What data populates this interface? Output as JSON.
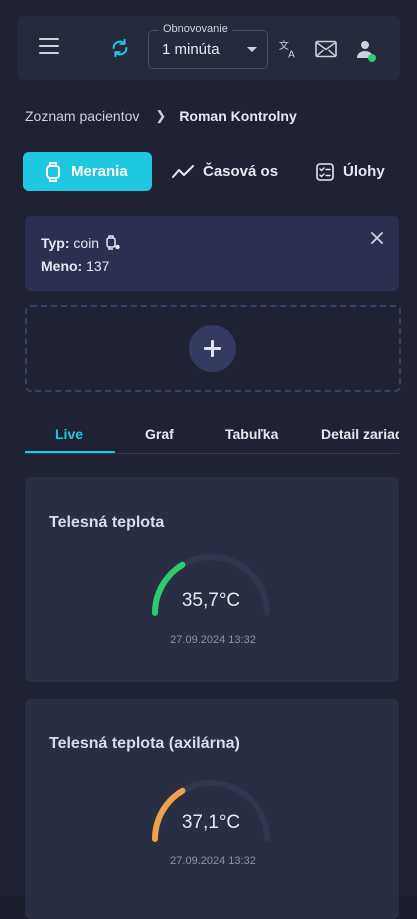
{
  "header": {
    "refresh_select": {
      "legend": "Obnovovanie",
      "value": "1 minúta"
    },
    "icons": [
      "menu-icon",
      "refresh-icon",
      "translate-icon",
      "mail-icon",
      "user-icon"
    ],
    "status_color": "#2ecc71"
  },
  "breadcrumb": {
    "parent": "Zoznam pacientov",
    "current": "Roman Kontrolny"
  },
  "tabs": [
    {
      "label": "Merania",
      "icon": "watch-icon",
      "active": true
    },
    {
      "label": "Časová os",
      "icon": "trend-icon"
    },
    {
      "label": "Úlohy",
      "icon": "tasks-icon"
    }
  ],
  "device": {
    "type_label": "Typ:",
    "type_value": "coin",
    "name_label": "Meno:",
    "name_value": "137"
  },
  "subtabs": [
    {
      "label": "Live",
      "active": true
    },
    {
      "label": "Graf"
    },
    {
      "label": "Tabuľka"
    },
    {
      "label": "Detail zariadenia"
    }
  ],
  "measurements": [
    {
      "title": "Telesná teplota",
      "value": "35,7°C",
      "timestamp": "27.09.2024 13:32",
      "level": 0.33,
      "color": "#2ecc71"
    },
    {
      "title": "Telesná teplota (axilárna)",
      "value": "37,1°C",
      "timestamp": "27.09.2024 13:32",
      "level": 0.33,
      "color": "#f0a04b"
    }
  ],
  "colors": {
    "accent": "#1ec8e0",
    "background": "#1f2232",
    "card": "#2a2e42"
  }
}
